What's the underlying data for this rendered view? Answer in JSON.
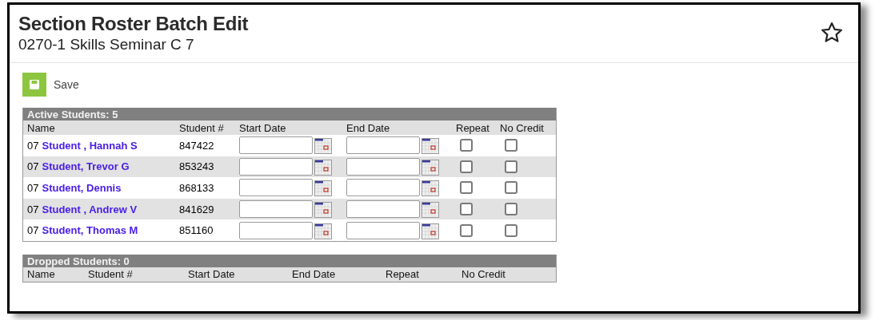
{
  "header": {
    "title": "Section Roster Batch Edit",
    "subtitle": "0270-1 Skills Seminar C 7"
  },
  "toolbar": {
    "save": "Save"
  },
  "active": {
    "title": "Active Students: 5",
    "columns": [
      "Name",
      "Student #",
      "Start Date",
      "End Date",
      "Repeat",
      "No Credit"
    ],
    "rows": [
      {
        "grade": "07",
        "name": "Student , Hannah S",
        "student_number": "847422",
        "repeat": false,
        "no_credit": false
      },
      {
        "grade": "07",
        "name": "Student, Trevor G",
        "student_number": "853243",
        "repeat": false,
        "no_credit": false
      },
      {
        "grade": "07",
        "name": "Student, Dennis",
        "student_number": "868133",
        "repeat": false,
        "no_credit": false
      },
      {
        "grade": "07",
        "name": "Student , Andrew V",
        "student_number": "841629",
        "repeat": false,
        "no_credit": false
      },
      {
        "grade": "07",
        "name": "Student, Thomas M",
        "student_number": "851160",
        "repeat": false,
        "no_credit": false
      }
    ]
  },
  "dropped": {
    "title": "Dropped Students: 0",
    "columns": [
      "Name",
      "Student #",
      "Start Date",
      "End Date",
      "Repeat",
      "No Credit"
    ]
  }
}
